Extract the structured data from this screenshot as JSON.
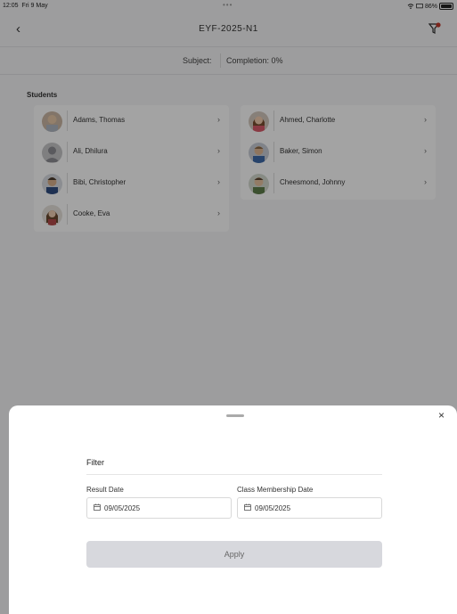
{
  "status_bar": {
    "time": "12:05",
    "date": "Fri 9 May",
    "battery": "86%"
  },
  "nav": {
    "title": "EYF-2025-N1"
  },
  "info": {
    "subject_label": "Subject:",
    "completion": "Completion: 0%"
  },
  "students": {
    "label": "Students",
    "left": [
      {
        "name": "Adams, Thomas"
      },
      {
        "name": "Ali, Dhilura"
      },
      {
        "name": "Bibi, Christopher"
      },
      {
        "name": "Cooke, Eva"
      }
    ],
    "right": [
      {
        "name": "Ahmed, Charlotte"
      },
      {
        "name": "Baker, Simon"
      },
      {
        "name": "Cheesmond, Johnny"
      }
    ]
  },
  "filter_sheet": {
    "title": "Filter",
    "result_date_label": "Result Date",
    "result_date_value": "09/05/2025",
    "membership_date_label": "Class Membership Date",
    "membership_date_value": "09/05/2025",
    "apply_label": "Apply",
    "close_glyph": "×"
  },
  "colors": {
    "accent": "#c0392b",
    "overlay": "rgba(0,0,0,0.36)",
    "button_bg": "#d7d8dd"
  }
}
